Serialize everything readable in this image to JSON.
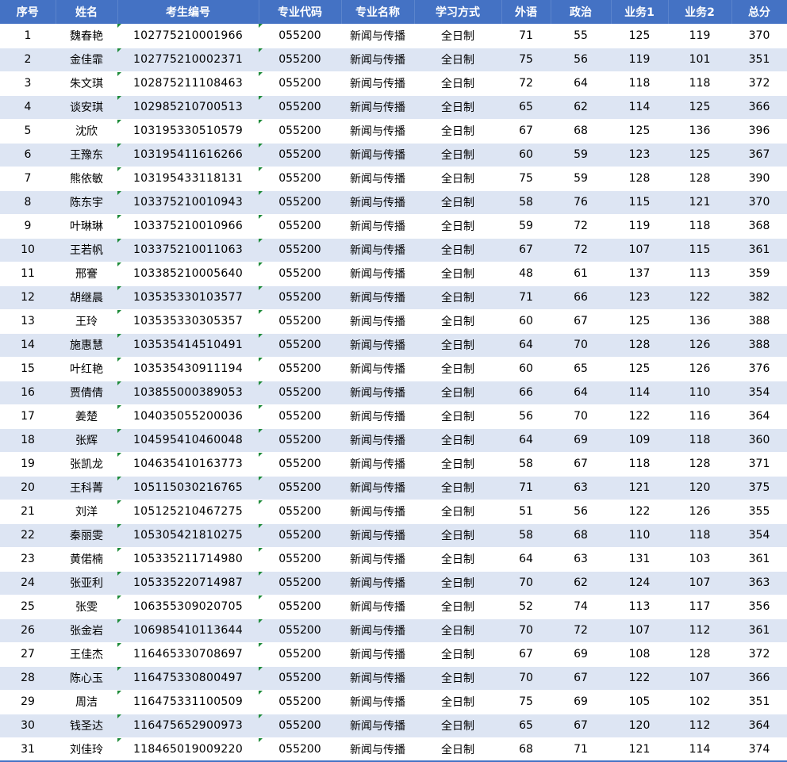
{
  "columns": [
    "序号",
    "姓名",
    "考生编号",
    "专业代码",
    "专业名称",
    "学习方式",
    "外语",
    "政治",
    "业务1",
    "业务2",
    "总分"
  ],
  "rows": [
    [
      "1",
      "魏春艳",
      "102775210001966",
      "055200",
      "新闻与传播",
      "全日制",
      "71",
      "55",
      "125",
      "119",
      "370"
    ],
    [
      "2",
      "金佳霏",
      "102775210002371",
      "055200",
      "新闻与传播",
      "全日制",
      "75",
      "56",
      "119",
      "101",
      "351"
    ],
    [
      "3",
      "朱文琪",
      "102875211108463",
      "055200",
      "新闻与传播",
      "全日制",
      "72",
      "64",
      "118",
      "118",
      "372"
    ],
    [
      "4",
      "谈安琪",
      "102985210700513",
      "055200",
      "新闻与传播",
      "全日制",
      "65",
      "62",
      "114",
      "125",
      "366"
    ],
    [
      "5",
      "沈欣",
      "103195330510579",
      "055200",
      "新闻与传播",
      "全日制",
      "67",
      "68",
      "125",
      "136",
      "396"
    ],
    [
      "6",
      "王豫东",
      "103195411616266",
      "055200",
      "新闻与传播",
      "全日制",
      "60",
      "59",
      "123",
      "125",
      "367"
    ],
    [
      "7",
      "熊依敏",
      "103195433118131",
      "055200",
      "新闻与传播",
      "全日制",
      "75",
      "59",
      "128",
      "128",
      "390"
    ],
    [
      "8",
      "陈东宇",
      "103375210010943",
      "055200",
      "新闻与传播",
      "全日制",
      "58",
      "76",
      "115",
      "121",
      "370"
    ],
    [
      "9",
      "叶琳琳",
      "103375210010966",
      "055200",
      "新闻与传播",
      "全日制",
      "59",
      "72",
      "119",
      "118",
      "368"
    ],
    [
      "10",
      "王若帆",
      "103375210011063",
      "055200",
      "新闻与传播",
      "全日制",
      "67",
      "72",
      "107",
      "115",
      "361"
    ],
    [
      "11",
      "邢謇",
      "103385210005640",
      "055200",
      "新闻与传播",
      "全日制",
      "48",
      "61",
      "137",
      "113",
      "359"
    ],
    [
      "12",
      "胡继晨",
      "103535330103577",
      "055200",
      "新闻与传播",
      "全日制",
      "71",
      "66",
      "123",
      "122",
      "382"
    ],
    [
      "13",
      "王玲",
      "103535330305357",
      "055200",
      "新闻与传播",
      "全日制",
      "60",
      "67",
      "125",
      "136",
      "388"
    ],
    [
      "14",
      "施惠慧",
      "103535414510491",
      "055200",
      "新闻与传播",
      "全日制",
      "64",
      "70",
      "128",
      "126",
      "388"
    ],
    [
      "15",
      "叶红艳",
      "103535430911194",
      "055200",
      "新闻与传播",
      "全日制",
      "60",
      "65",
      "125",
      "126",
      "376"
    ],
    [
      "16",
      "贾倩倩",
      "103855000389053",
      "055200",
      "新闻与传播",
      "全日制",
      "66",
      "64",
      "114",
      "110",
      "354"
    ],
    [
      "17",
      "姜楚",
      "104035055200036",
      "055200",
      "新闻与传播",
      "全日制",
      "56",
      "70",
      "122",
      "116",
      "364"
    ],
    [
      "18",
      "张辉",
      "104595410460048",
      "055200",
      "新闻与传播",
      "全日制",
      "64",
      "69",
      "109",
      "118",
      "360"
    ],
    [
      "19",
      "张凯龙",
      "104635410163773",
      "055200",
      "新闻与传播",
      "全日制",
      "58",
      "67",
      "118",
      "128",
      "371"
    ],
    [
      "20",
      "王科菁",
      "105115030216765",
      "055200",
      "新闻与传播",
      "全日制",
      "71",
      "63",
      "121",
      "120",
      "375"
    ],
    [
      "21",
      "刘洋",
      "105125210467275",
      "055200",
      "新闻与传播",
      "全日制",
      "51",
      "56",
      "122",
      "126",
      "355"
    ],
    [
      "22",
      "秦丽雯",
      "105305421810275",
      "055200",
      "新闻与传播",
      "全日制",
      "58",
      "68",
      "110",
      "118",
      "354"
    ],
    [
      "23",
      "黄偌楠",
      "105335211714980",
      "055200",
      "新闻与传播",
      "全日制",
      "64",
      "63",
      "131",
      "103",
      "361"
    ],
    [
      "24",
      "张亚利",
      "105335220714987",
      "055200",
      "新闻与传播",
      "全日制",
      "70",
      "62",
      "124",
      "107",
      "363"
    ],
    [
      "25",
      "张雯",
      "106355309020705",
      "055200",
      "新闻与传播",
      "全日制",
      "52",
      "74",
      "113",
      "117",
      "356"
    ],
    [
      "26",
      "张金岩",
      "106985410113644",
      "055200",
      "新闻与传播",
      "全日制",
      "70",
      "72",
      "107",
      "112",
      "361"
    ],
    [
      "27",
      "王佳杰",
      "116465330708697",
      "055200",
      "新闻与传播",
      "全日制",
      "67",
      "69",
      "108",
      "128",
      "372"
    ],
    [
      "28",
      "陈心玉",
      "116475330800497",
      "055200",
      "新闻与传播",
      "全日制",
      "70",
      "67",
      "122",
      "107",
      "366"
    ],
    [
      "29",
      "周洁",
      "116475331100509",
      "055200",
      "新闻与传播",
      "全日制",
      "75",
      "69",
      "105",
      "102",
      "351"
    ],
    [
      "30",
      "钱圣达",
      "116475652900973",
      "055200",
      "新闻与传播",
      "全日制",
      "65",
      "67",
      "120",
      "112",
      "364"
    ],
    [
      "31",
      "刘佳玲",
      "118465019009220",
      "055200",
      "新闻与传播",
      "全日制",
      "68",
      "71",
      "121",
      "114",
      "374"
    ]
  ],
  "colors": {
    "header_bg": "#4472c4",
    "header_text": "#ffffff",
    "band_row_bg": "#dde5f3",
    "text_marker": "#1e8b3a"
  }
}
